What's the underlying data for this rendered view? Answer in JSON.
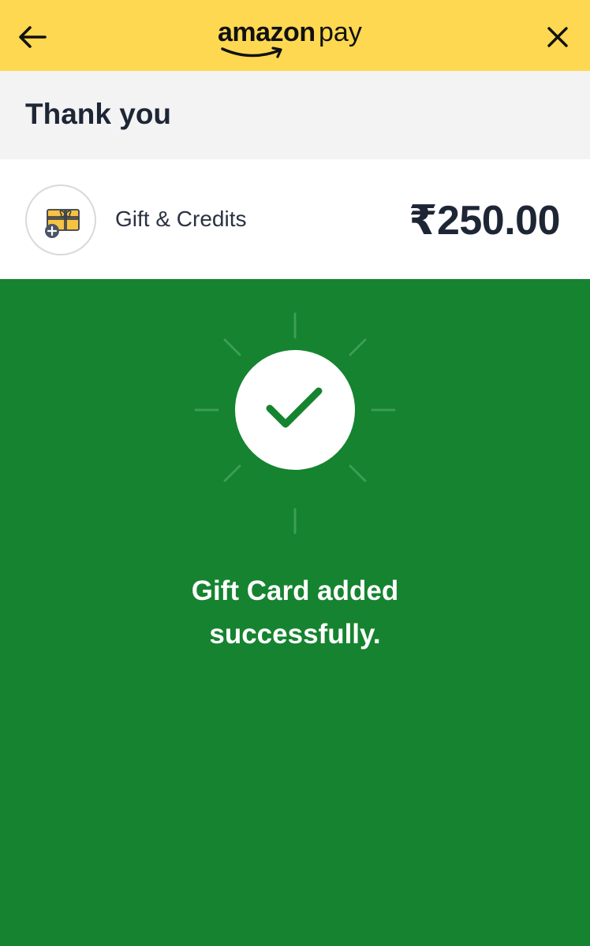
{
  "header": {
    "logo_text_1": "amazon",
    "logo_text_2": "pay",
    "back_icon": "arrow-left-icon",
    "close_icon": "close-icon",
    "background": "#fed851"
  },
  "thank_you": {
    "title": "Thank you"
  },
  "gift_row": {
    "icon": "gift-card-add-icon",
    "label": "Gift & Credits",
    "amount": "₹250.00"
  },
  "success": {
    "background": "#15832f",
    "icon": "checkmark-icon",
    "message_line_1": "Gift Card added",
    "message_line_2": "successfully."
  }
}
